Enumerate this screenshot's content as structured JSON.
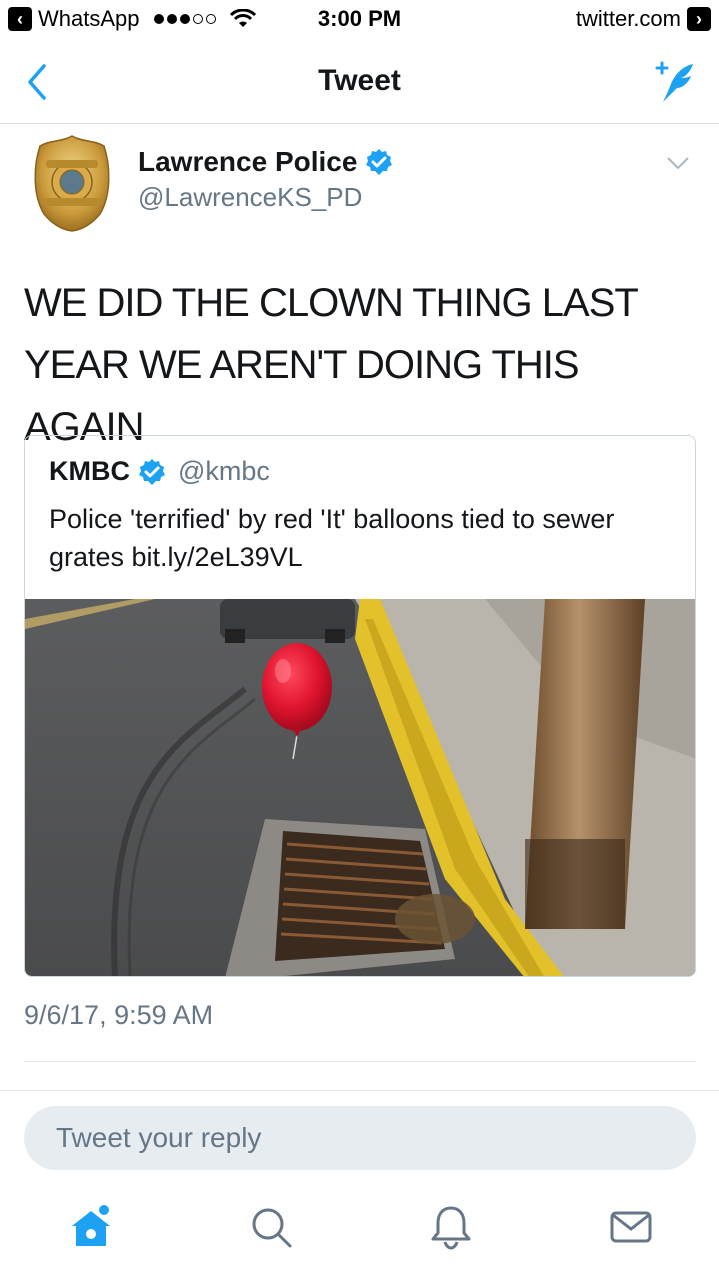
{
  "status_bar": {
    "back_app": "WhatsApp",
    "time": "3:00 PM",
    "url": "twitter.com"
  },
  "nav": {
    "title": "Tweet"
  },
  "tweet": {
    "author_name": "Lawrence Police",
    "handle": "@LawrenceKS_PD",
    "text": "WE DID THE CLOWN THING LAST YEAR WE AREN'T DOING THIS AGAIN",
    "timestamp": "9/6/17, 9:59 AM",
    "avatar_badge_text": [
      "LAWRENCE",
      "POLICE",
      "DEPARTMENT",
      "KS"
    ]
  },
  "quoted_tweet": {
    "author_name": "KMBC",
    "handle": "@kmbc",
    "text": "Police 'terrified' by red 'It' balloons tied to sewer grates bit.ly/2eL39VL"
  },
  "reply": {
    "placeholder": "Tweet your reply"
  },
  "tabs": [
    "home-icon",
    "search-icon",
    "notifications-icon",
    "messages-icon"
  ],
  "colors": {
    "accent": "#1da1f2",
    "text": "#14171a",
    "secondary": "#657786",
    "divider": "#e1e8ed"
  }
}
